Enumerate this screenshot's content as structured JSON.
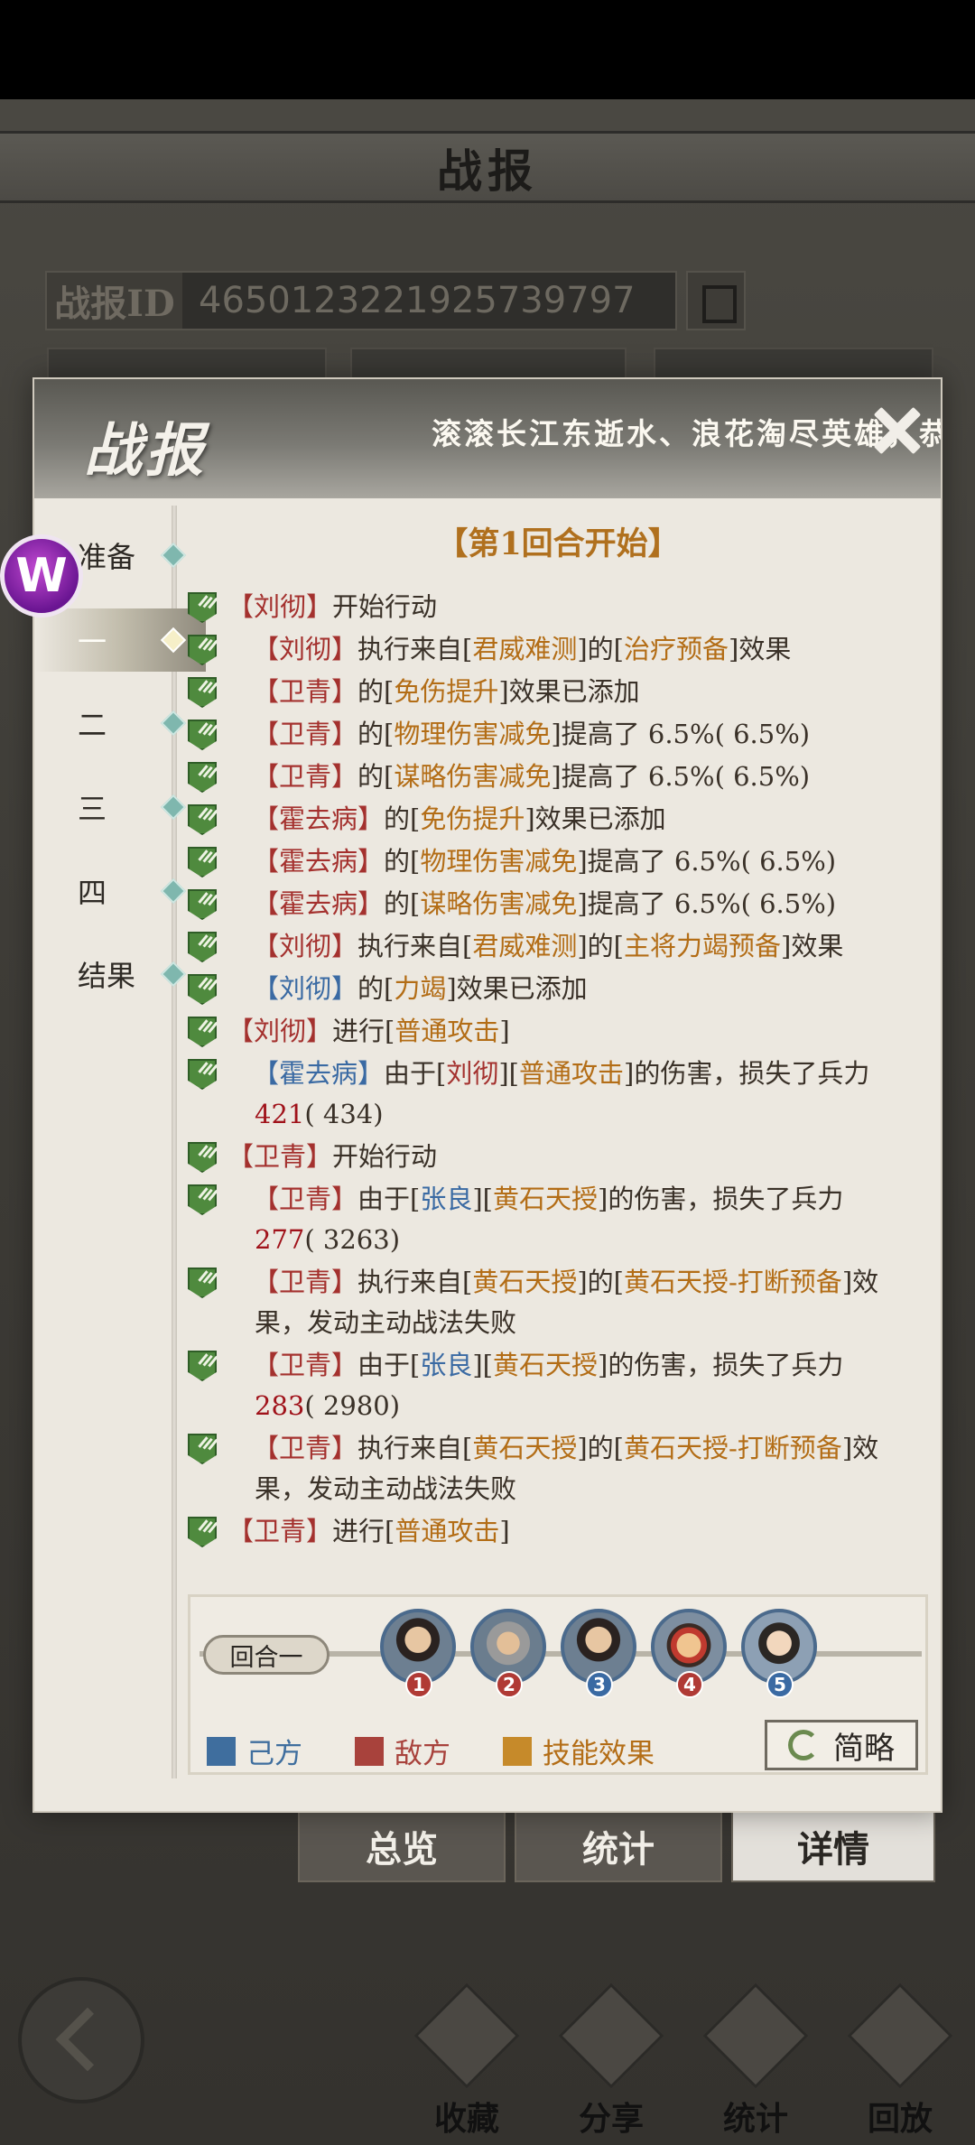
{
  "background": {
    "title": "战报",
    "report_id_label": "战报ID",
    "report_id_value": "4650123221925739797",
    "tabs": [
      "总览",
      "统计",
      "详情"
    ],
    "nav": [
      "收藏",
      "分享",
      "统计",
      "回放"
    ]
  },
  "modal": {
    "title": "战报",
    "marquee": "滚滚长江东逝水、浪花淘尽英雄，恭喜",
    "logo_letter": "W",
    "sidebar": [
      "准备",
      "一",
      "二",
      "三",
      "四",
      "结果"
    ],
    "round_title": "【第1回合开始】",
    "log": [
      {
        "sub": false,
        "parts": [
          [
            "e",
            "【刘彻】"
          ],
          [
            "n",
            "开始行动"
          ]
        ]
      },
      {
        "sub": true,
        "parts": [
          [
            "e",
            "【刘彻】"
          ],
          [
            "n",
            "执行来自["
          ],
          [
            "s",
            "君威难测"
          ],
          [
            "n",
            "]的["
          ],
          [
            "s",
            "治疗预备"
          ],
          [
            "n",
            "]效果"
          ]
        ]
      },
      {
        "sub": true,
        "parts": [
          [
            "e",
            "【卫青】"
          ],
          [
            "n",
            "的["
          ],
          [
            "s",
            "免伤提升"
          ],
          [
            "n",
            "]效果已添加"
          ]
        ]
      },
      {
        "sub": true,
        "parts": [
          [
            "e",
            "【卫青】"
          ],
          [
            "n",
            "的["
          ],
          [
            "s",
            "物理伤害减免"
          ],
          [
            "n",
            "]提高了 6.5%( 6.5%)"
          ]
        ]
      },
      {
        "sub": true,
        "parts": [
          [
            "e",
            "【卫青】"
          ],
          [
            "n",
            "的["
          ],
          [
            "s",
            "谋略伤害减免"
          ],
          [
            "n",
            "]提高了 6.5%( 6.5%)"
          ]
        ]
      },
      {
        "sub": true,
        "parts": [
          [
            "e",
            "【霍去病】"
          ],
          [
            "n",
            "的["
          ],
          [
            "s",
            "免伤提升"
          ],
          [
            "n",
            "]效果已添加"
          ]
        ]
      },
      {
        "sub": true,
        "parts": [
          [
            "e",
            "【霍去病】"
          ],
          [
            "n",
            "的["
          ],
          [
            "s",
            "物理伤害减免"
          ],
          [
            "n",
            "]提高了 6.5%( 6.5%)"
          ]
        ]
      },
      {
        "sub": true,
        "parts": [
          [
            "e",
            "【霍去病】"
          ],
          [
            "n",
            "的["
          ],
          [
            "s",
            "谋略伤害减免"
          ],
          [
            "n",
            "]提高了 6.5%( 6.5%)"
          ]
        ]
      },
      {
        "sub": true,
        "parts": [
          [
            "e",
            "【刘彻】"
          ],
          [
            "n",
            "执行来自["
          ],
          [
            "s",
            "君威难测"
          ],
          [
            "n",
            "]的["
          ],
          [
            "s",
            "主将力竭预备"
          ],
          [
            "n",
            "]效果"
          ]
        ]
      },
      {
        "sub": true,
        "parts": [
          [
            "a",
            "【刘彻】"
          ],
          [
            "n",
            "的["
          ],
          [
            "s",
            "力竭"
          ],
          [
            "n",
            "]效果已添加"
          ]
        ]
      },
      {
        "sub": false,
        "parts": [
          [
            "e",
            "【刘彻】"
          ],
          [
            "n",
            "进行["
          ],
          [
            "s",
            "普通攻击"
          ],
          [
            "n",
            "]"
          ]
        ]
      },
      {
        "sub": true,
        "parts": [
          [
            "a",
            "【霍去病】"
          ],
          [
            "n",
            "由于["
          ],
          [
            "e",
            "刘彻"
          ],
          [
            "n",
            "]["
          ],
          [
            "s",
            "普通攻击"
          ],
          [
            "n",
            "]的伤害，损失了兵力 "
          ],
          [
            "num",
            "421"
          ],
          [
            "n",
            "( 434)"
          ]
        ]
      },
      {
        "sub": false,
        "parts": [
          [
            "e",
            "【卫青】"
          ],
          [
            "n",
            "开始行动"
          ]
        ]
      },
      {
        "sub": true,
        "parts": [
          [
            "e",
            "【卫青】"
          ],
          [
            "n",
            "由于["
          ],
          [
            "a",
            "张良"
          ],
          [
            "n",
            "]["
          ],
          [
            "s",
            "黄石天授"
          ],
          [
            "n",
            "]的伤害，损失了兵力 "
          ],
          [
            "num",
            "277"
          ],
          [
            "n",
            "( 3263)"
          ]
        ]
      },
      {
        "sub": true,
        "parts": [
          [
            "e",
            "【卫青】"
          ],
          [
            "n",
            "执行来自["
          ],
          [
            "s",
            "黄石天授"
          ],
          [
            "n",
            "]的["
          ],
          [
            "s",
            "黄石天授-打断预备"
          ],
          [
            "n",
            "]效果，发动主动战法失败"
          ]
        ]
      },
      {
        "sub": true,
        "parts": [
          [
            "e",
            "【卫青】"
          ],
          [
            "n",
            "由于["
          ],
          [
            "a",
            "张良"
          ],
          [
            "n",
            "]["
          ],
          [
            "s",
            "黄石天授"
          ],
          [
            "n",
            "]的伤害，损失了兵力 "
          ],
          [
            "num",
            "283"
          ],
          [
            "n",
            "( 2980)"
          ]
        ]
      },
      {
        "sub": true,
        "parts": [
          [
            "e",
            "【卫青】"
          ],
          [
            "n",
            "执行来自["
          ],
          [
            "s",
            "黄石天授"
          ],
          [
            "n",
            "]的["
          ],
          [
            "s",
            "黄石天授-打断预备"
          ],
          [
            "n",
            "]效果，发动主动战法失败"
          ]
        ]
      },
      {
        "sub": false,
        "parts": [
          [
            "e",
            "【卫青】"
          ],
          [
            "n",
            "进行["
          ],
          [
            "s",
            "普通攻击"
          ],
          [
            "n",
            "]"
          ]
        ]
      }
    ],
    "turnbar": {
      "round_label": "回合一",
      "heroes": [
        "1",
        "2",
        "3",
        "4",
        "5"
      ],
      "hero_badge_colors": [
        "#b03a35",
        "#b03a35",
        "#3a6aa3",
        "#b03a35",
        "#3a6aa3"
      ]
    },
    "legend": [
      {
        "label": "己方",
        "color": "#3f6e9e"
      },
      {
        "label": "敌方",
        "color": "#a8423c"
      },
      {
        "label": "技能效果",
        "color": "#c68a2a"
      }
    ],
    "brief_button": "简略"
  }
}
